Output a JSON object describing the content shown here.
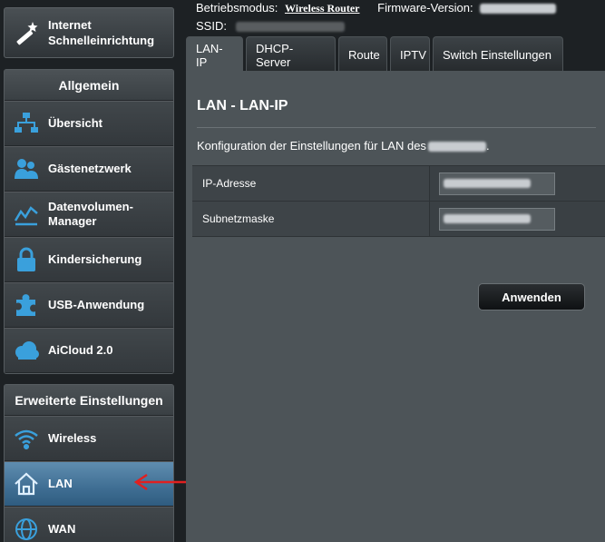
{
  "header": {
    "mode_label": "Betriebsmodus:",
    "mode_value": "Wireless Router",
    "firmware_label": "Firmware-Version:",
    "ssid_label": "SSID:"
  },
  "quick_setup": {
    "line1": "Internet",
    "line2": "Schnelleinrichtung",
    "icon": "magic-wand-icon"
  },
  "general": {
    "title": "Allgemein",
    "items": [
      {
        "label": "Übersicht",
        "icon": "network-map-icon"
      },
      {
        "label": "Gästenetzwerk",
        "icon": "guests-icon"
      },
      {
        "label": "Datenvolumen-",
        "label2": "Manager",
        "icon": "traffic-chart-icon"
      },
      {
        "label": "Kindersicherung",
        "icon": "lock-icon"
      },
      {
        "label": "USB-Anwendung",
        "icon": "puzzle-icon"
      },
      {
        "label": "AiCloud 2.0",
        "icon": "cloud-icon"
      }
    ]
  },
  "advanced": {
    "title": "Erweiterte Einstellungen",
    "items": [
      {
        "label": "Wireless",
        "icon": "wifi-icon"
      },
      {
        "label": "LAN",
        "icon": "home-icon",
        "active": true
      },
      {
        "label": "WAN",
        "icon": "globe-icon"
      }
    ]
  },
  "tabs": [
    "LAN-IP",
    "DHCP-Server",
    "Route",
    "IPTV",
    "Switch Einstellungen"
  ],
  "panel": {
    "title": "LAN - LAN-IP",
    "description": "Konfiguration der Einstellungen für LAN des",
    "rows": [
      {
        "label": "IP-Adresse"
      },
      {
        "label": "Subnetzmaske"
      }
    ],
    "apply": "Anwenden"
  },
  "colors": {
    "accent_active": "#4f7fa4",
    "arrow": "#e02020",
    "panel_bg": "#4d5458"
  }
}
